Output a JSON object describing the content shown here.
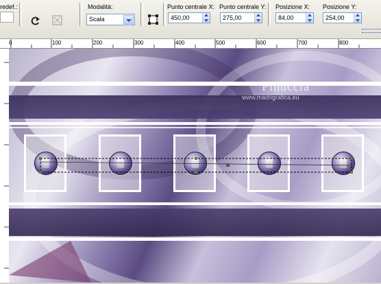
{
  "toolbar": {
    "preset_label": "redef.:",
    "mode_label": "Modalità:",
    "mode_value": "Scala",
    "center_x_label": "Punto centrale X:",
    "center_x_value": "450,00",
    "center_y_label": "Punto centrale Y:",
    "center_y_value": "275,00",
    "pos_x_label": "Posizione X:",
    "pos_x_value": "84,00",
    "pos_y_label": "Posizione Y:",
    "pos_y_value": "254,00"
  },
  "ruler": {
    "ticks": [
      "0",
      "100",
      "200",
      "300",
      "400",
      "500",
      "600",
      "700",
      "800"
    ]
  },
  "watermark": {
    "line1": "Pinuccia",
    "line2": "www.madrigrafica.eu"
  },
  "icons": [
    "reset-icon",
    "pick-tool-icon",
    "select-handle-icon"
  ],
  "colors": {
    "accent": "#5a4b82",
    "band_dark": "#3b2f5c",
    "field_border": "#7f9db9"
  }
}
